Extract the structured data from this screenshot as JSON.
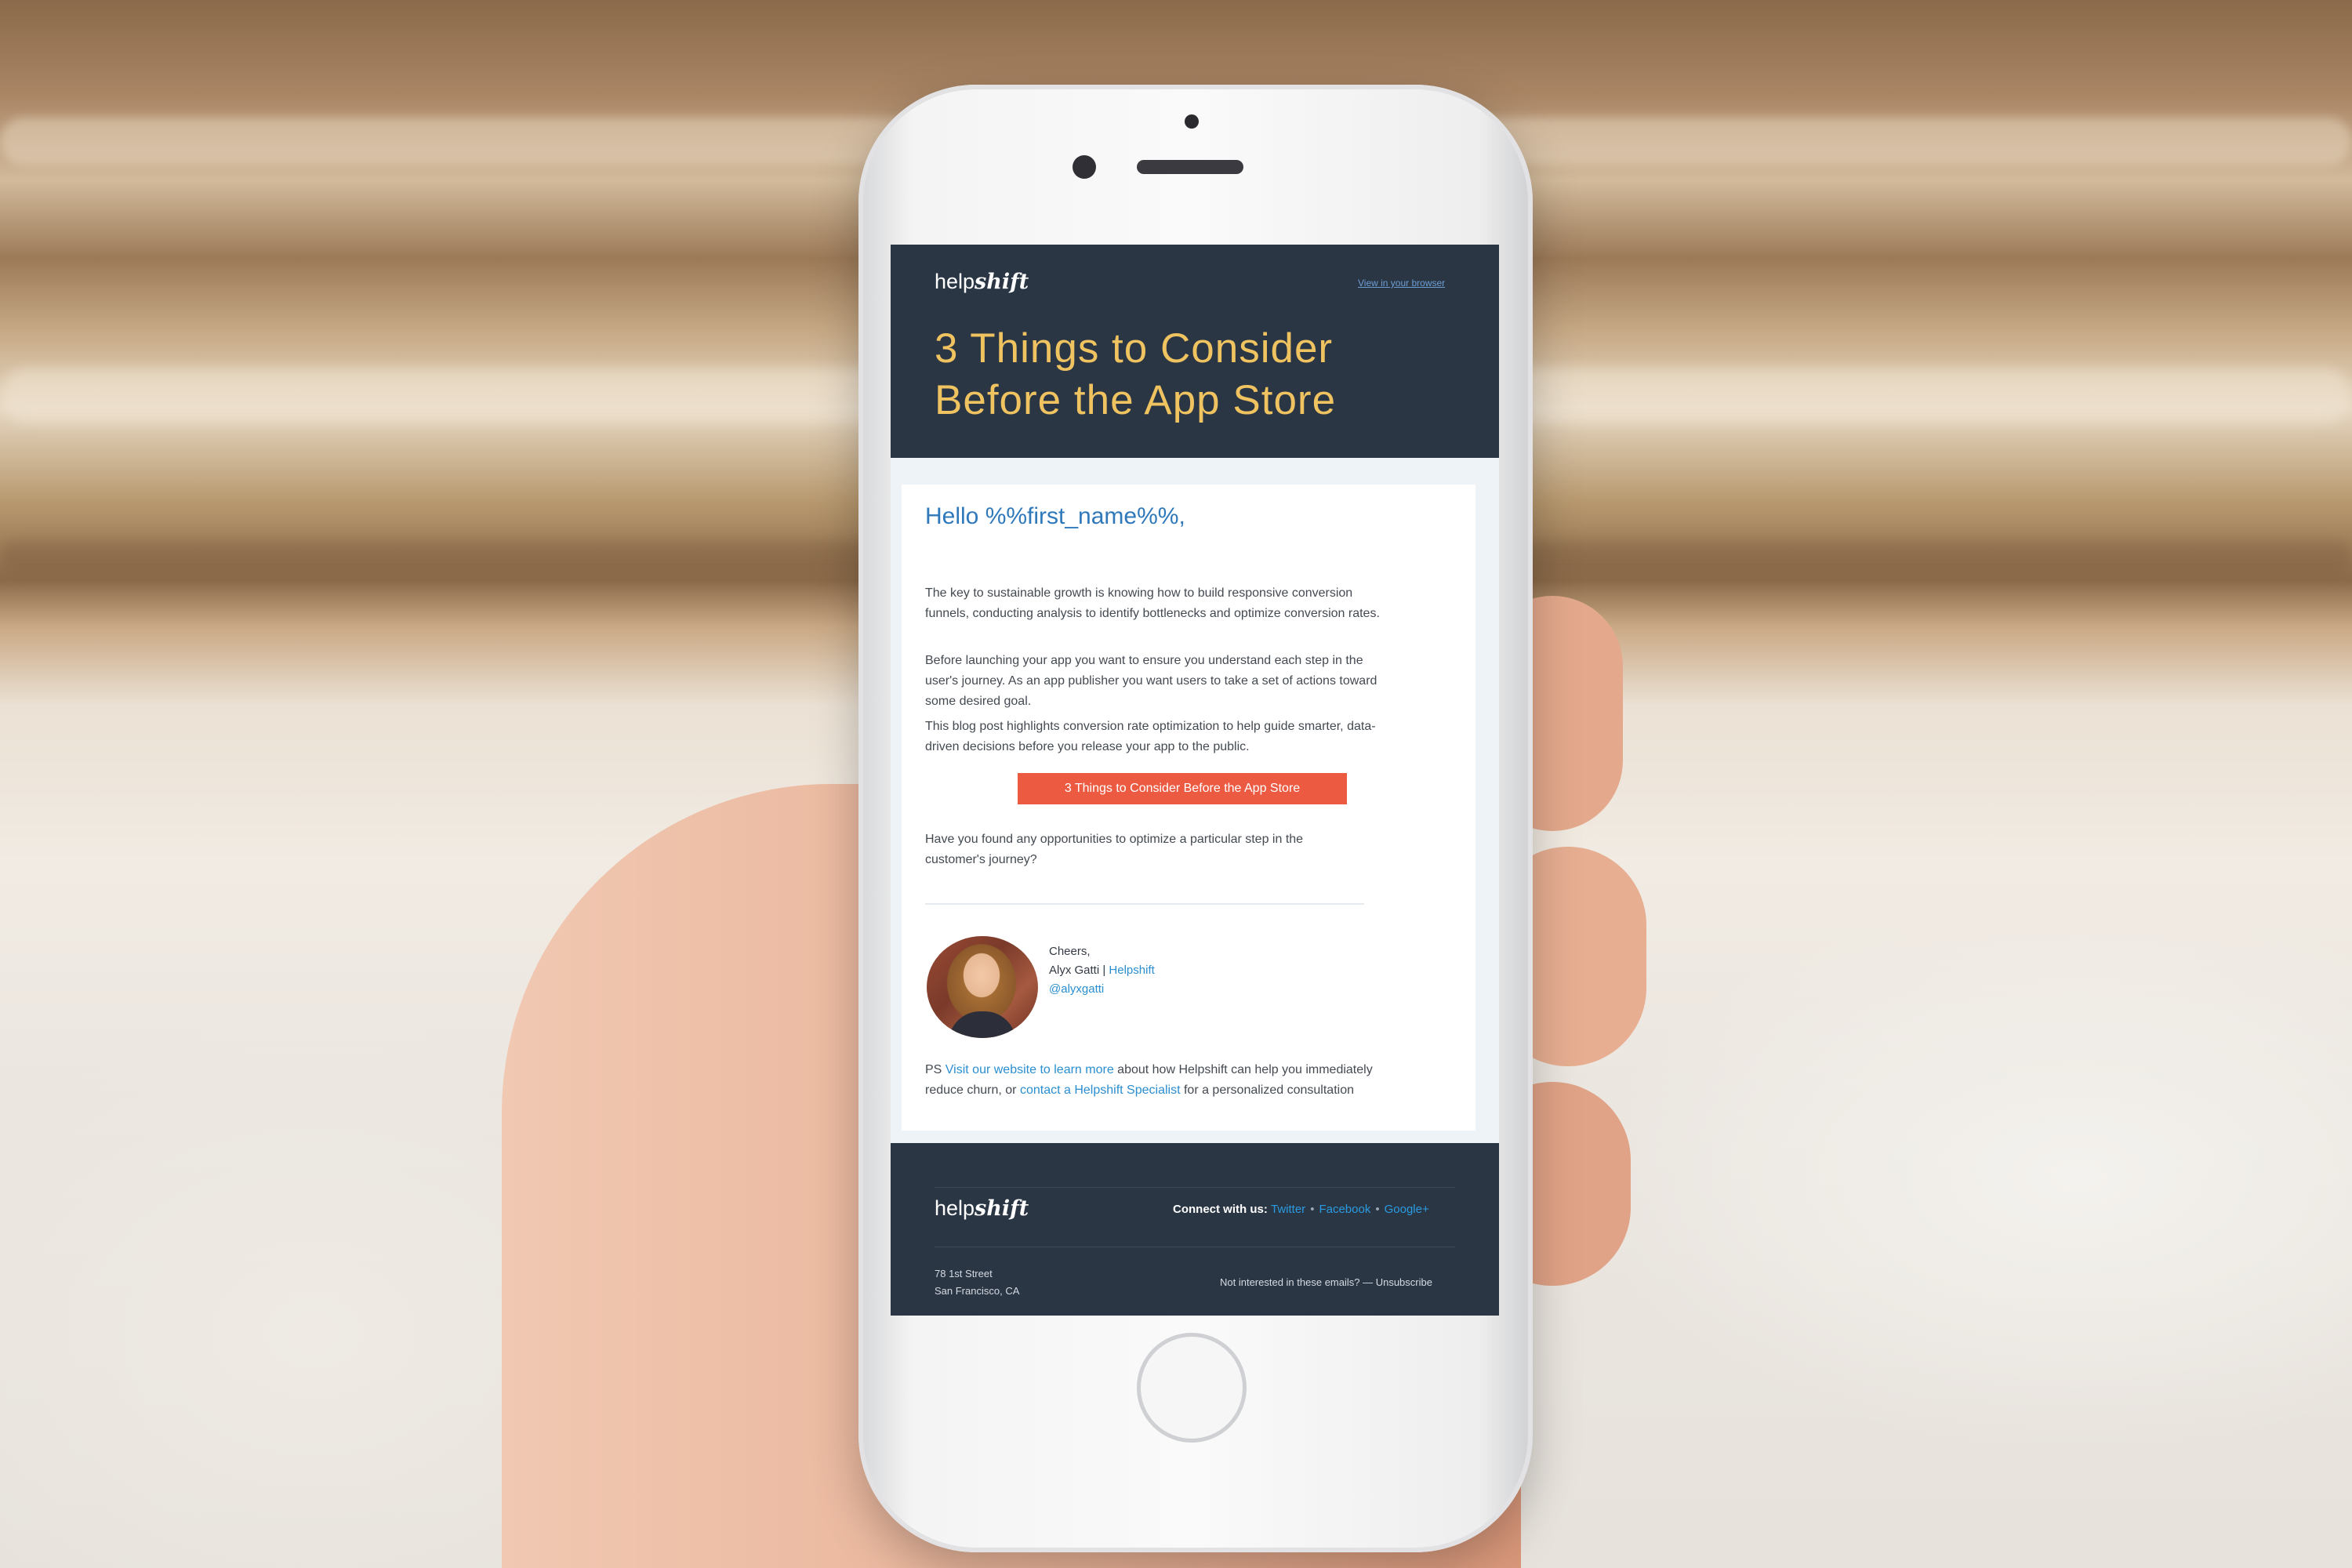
{
  "email": {
    "logo_prefix": "help",
    "logo_suffix": "shift",
    "view_in_browser": "View in your browser",
    "hero_title_line1": "3 Things to Consider",
    "hero_title_line2": "Before the App Store",
    "greeting": "Hello %%first_name%%,",
    "paragraphs": [
      [
        "The key to sustainable growth is knowing how to build responsive conversion",
        "funnels, conducting analysis to identify bottlenecks and optimize conversion rates."
      ],
      [
        "Before launching your app you want to ensure you understand each step in the",
        "user's journey. As an app publisher you want users to take a set of actions toward",
        "some desired goal."
      ],
      [
        "This blog post highlights conversion rate optimization to help guide smarter, data-",
        "driven decisions before you release your app to the public."
      ]
    ],
    "cta_label": "3 Things to Consider Before the App Store",
    "question": [
      "Have you found any opportunities to optimize a particular step in the",
      "customer's journey?"
    ],
    "signature": {
      "cheers": "Cheers,",
      "name": "Alyx Gatti |",
      "company": "Helpshift",
      "handle": "@alyxgatti"
    },
    "ps": {
      "prefix": "PS",
      "link1": "Visit our website to learn more",
      "middle": "about how Helpshift can help you immediately",
      "line2_start": "reduce churn, or",
      "link2": "contact a Helpshift Specialist",
      "end": "for a personalized consultation"
    },
    "footer": {
      "connect_label": "Connect with us:",
      "social": [
        "Twitter",
        "Facebook",
        "Google+"
      ],
      "separator": "•",
      "address_line1": "78 1st Street",
      "address_line2": "San Francisco, CA",
      "unsubscribe": "Not interested in these emails? — Unsubscribe"
    }
  },
  "colors": {
    "header_bg": "#2b3645",
    "title_gold": "#f0c361",
    "greeting_blue": "#2f78ba",
    "cta_red": "#ec5a42",
    "link_blue": "#2a8ed0"
  },
  "icons": [
    "phone-camera-icon",
    "phone-home-button-icon"
  ]
}
